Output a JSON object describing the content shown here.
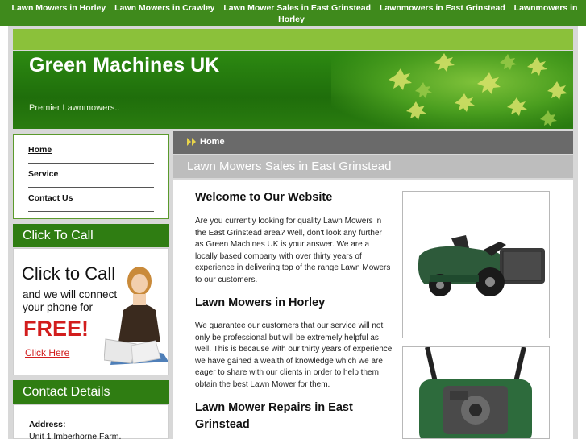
{
  "top_nav": {
    "links": [
      "Lawn Mowers in Horley",
      "Lawn Mowers in Crawley",
      "Lawn Mower Sales in East Grinstead",
      "Lawnmowers in East Grinstead",
      "Lawnmowers in Horley"
    ]
  },
  "header": {
    "title": "Green Machines UK",
    "tagline": "Premier Lawnmowers.."
  },
  "sidebar": {
    "nav": [
      "Home",
      "Service",
      "Contact Us"
    ],
    "call_box": {
      "heading": "Click To Call",
      "line1": "Click to Call",
      "line2": "and we will connect your phone for",
      "free": "FREE!",
      "link": "Click Here"
    },
    "contact_box": {
      "heading": "Contact Details",
      "address_label": "Address:",
      "address_line": "Unit 1 Imberhorne Farm,"
    }
  },
  "breadcrumb": {
    "label": "Home"
  },
  "main": {
    "page_heading": "Lawn Mowers Sales in East Grinstead",
    "welcome_heading": "Welcome to Our Website",
    "welcome_text": "Are you currently looking for quality Lawn Mowers in the East Grinstead area? Well, don't look any further as Green Machines UK is your answer. We are a locally based company with over thirty years of experience in delivering top of the range Lawn Mowers to our customers.",
    "horley_heading": "Lawn Mowers in Horley",
    "horley_text": "We guarantee our customers that our service will not only be professional but will be extremely helpful as well. This is because with our thirty years of experience we have gained a wealth of knowledge which we are eager to share with our clients in order to help them obtain the best Lawn Mower for them.",
    "repairs_heading": "Lawn Mower Repairs in East Grinstead"
  },
  "colors": {
    "brand_green": "#2f7d12",
    "top_bar": "#3f8a1c",
    "accent_red": "#d21d1d",
    "breadcrumb_bg": "#6a6a6a"
  }
}
